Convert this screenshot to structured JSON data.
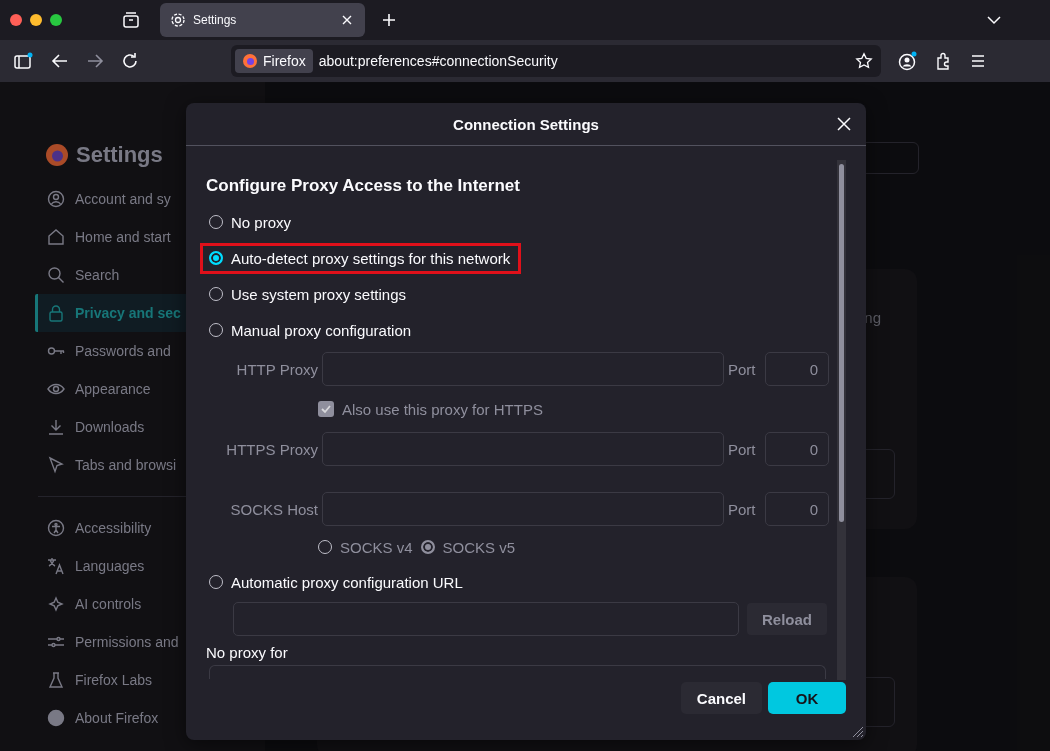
{
  "browser": {
    "tab": {
      "title": "Settings",
      "selected": true
    },
    "identity": "Firefox",
    "url": "about:preferences#connectionSecurity"
  },
  "sidebar": {
    "title": "Settings",
    "items": [
      {
        "label": "Account and sy",
        "selected": false
      },
      {
        "label": "Home and start",
        "selected": false
      },
      {
        "label": "Search",
        "selected": false
      },
      {
        "label": "Privacy and sec",
        "selected": true
      },
      {
        "label": "Passwords and",
        "selected": false
      },
      {
        "label": "Appearance",
        "selected": false
      },
      {
        "label": "Downloads",
        "selected": false
      },
      {
        "label": "Tabs and browsi",
        "selected": false
      }
    ],
    "items_secondary": [
      {
        "label": "Accessibility",
        "selected": false
      },
      {
        "label": "Languages",
        "selected": false
      },
      {
        "label": "AI controls",
        "selected": false
      },
      {
        "label": "Permissions and",
        "selected": false
      },
      {
        "label": "Firefox Labs",
        "selected": false
      },
      {
        "label": "About Firefox",
        "selected": false
      }
    ]
  },
  "background_text": "ng",
  "dialog": {
    "title": "Connection Settings",
    "heading": "Configure Proxy Access to the Internet",
    "modes": [
      {
        "label": "No proxy",
        "selected": false,
        "highlighted": false
      },
      {
        "label": "Auto-detect proxy settings for this network",
        "selected": true,
        "highlighted": true
      },
      {
        "label": "Use system proxy settings",
        "selected": false,
        "highlighted": false
      },
      {
        "label": "Manual proxy configuration",
        "selected": false,
        "highlighted": false
      },
      {
        "label": "Automatic proxy configuration URL",
        "selected": false,
        "highlighted": false
      }
    ],
    "manual": {
      "disabled": true,
      "http": {
        "label": "HTTP Proxy",
        "port_label": "Port",
        "port": "0"
      },
      "also_https": {
        "label": "Also use this proxy for HTTPS",
        "checked": true
      },
      "https": {
        "label": "HTTPS Proxy",
        "port_label": "Port",
        "port": "0"
      },
      "socks": {
        "label": "SOCKS Host",
        "port_label": "Port",
        "port": "0"
      },
      "socks_versions": [
        {
          "label": "SOCKS v4",
          "selected": false
        },
        {
          "label": "SOCKS v5",
          "selected": true
        }
      ]
    },
    "reload": "Reload",
    "no_proxy_label": "No proxy for",
    "buttons": [
      {
        "label": "Cancel",
        "kind": "secondary"
      },
      {
        "label": "OK",
        "kind": "primary"
      }
    ]
  }
}
